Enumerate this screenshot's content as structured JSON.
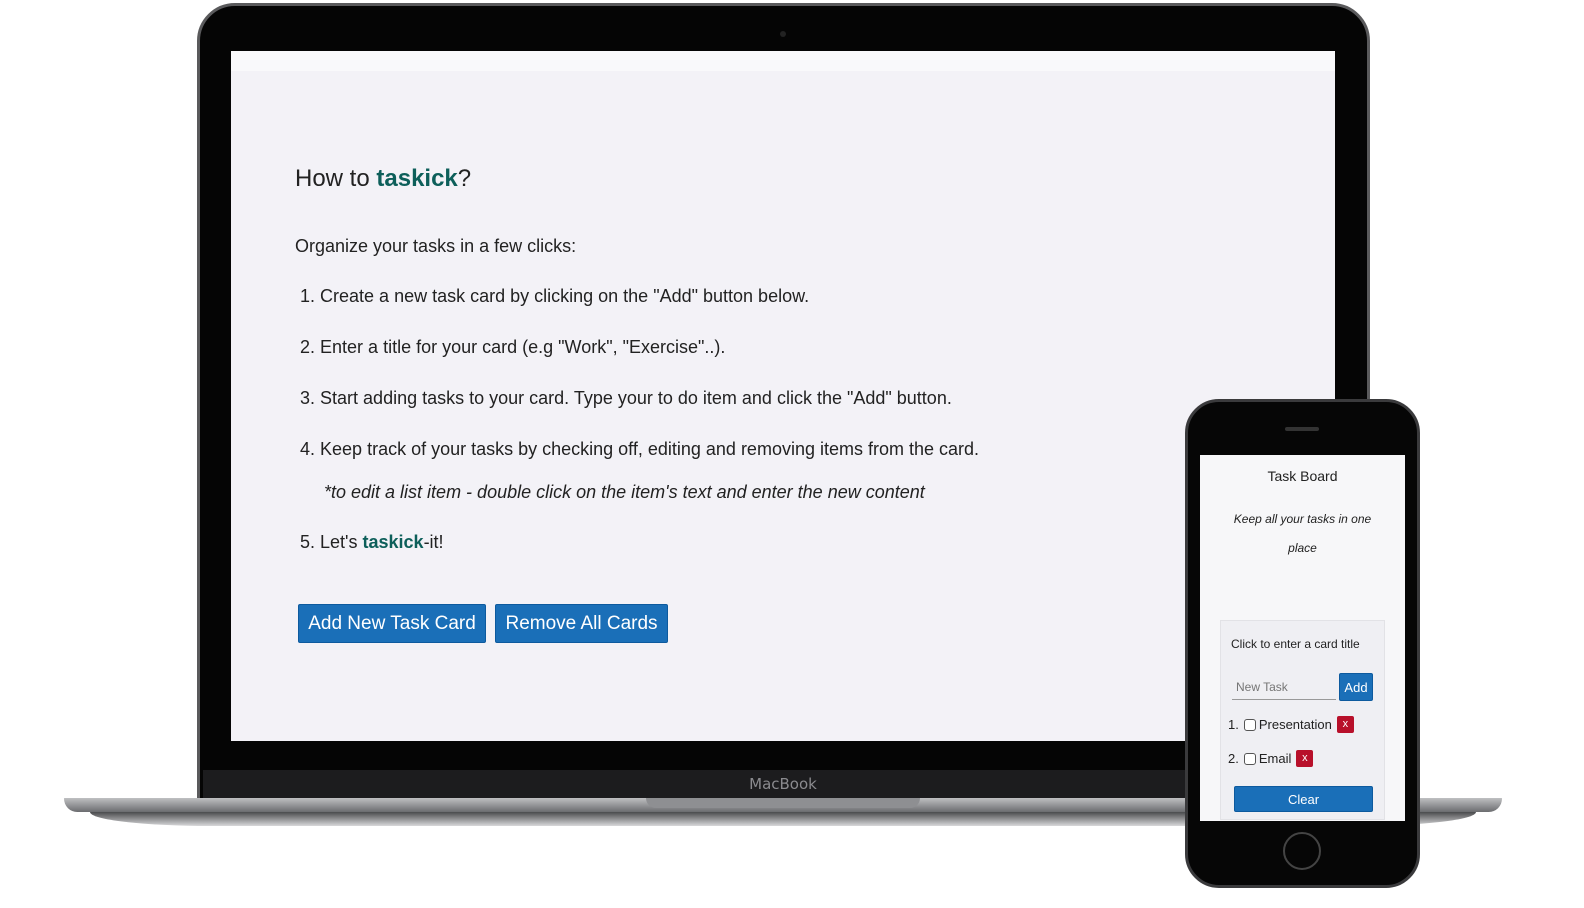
{
  "laptop": {
    "brand": "MacBook",
    "heading_prefix": "How to ",
    "heading_brand": "taskick",
    "heading_suffix": "?",
    "intro": "Organize your tasks in a few clicks:",
    "steps": [
      {
        "num": "1.",
        "text": "Create a new task card by clicking on the \"Add\" button below."
      },
      {
        "num": "2.",
        "text": "Enter a title for your card (e.g \"Work\", \"Exercise\"..)."
      },
      {
        "num": "3.",
        "text": "Start adding tasks to your card. Type your to do item and click the \"Add\" button."
      },
      {
        "num": "4.",
        "text": "Keep track of your tasks by checking off, editing and removing items from the card."
      },
      {
        "num": "5.",
        "prefix": "Let's ",
        "brand": "taskick",
        "suffix": "-it!"
      }
    ],
    "note": "*to edit a list item - double click on the item's text and enter the new content",
    "add_button": "Add New Task Card",
    "remove_button": "Remove All Cards"
  },
  "phone": {
    "title": "Task Board",
    "tagline_1": "Keep all your tasks in one",
    "tagline_2": "place",
    "card_title": "Click to enter a card title",
    "input_placeholder": "New Task",
    "add_label": "Add",
    "items": [
      {
        "num": "1.",
        "text": "Presentation",
        "remove": "x"
      },
      {
        "num": "2.",
        "text": "Email",
        "remove": "x"
      }
    ],
    "clear_label": "Clear"
  },
  "colors": {
    "accent": "#0d5f5a",
    "button": "#1a6fb8",
    "remove": "#b8102a"
  }
}
